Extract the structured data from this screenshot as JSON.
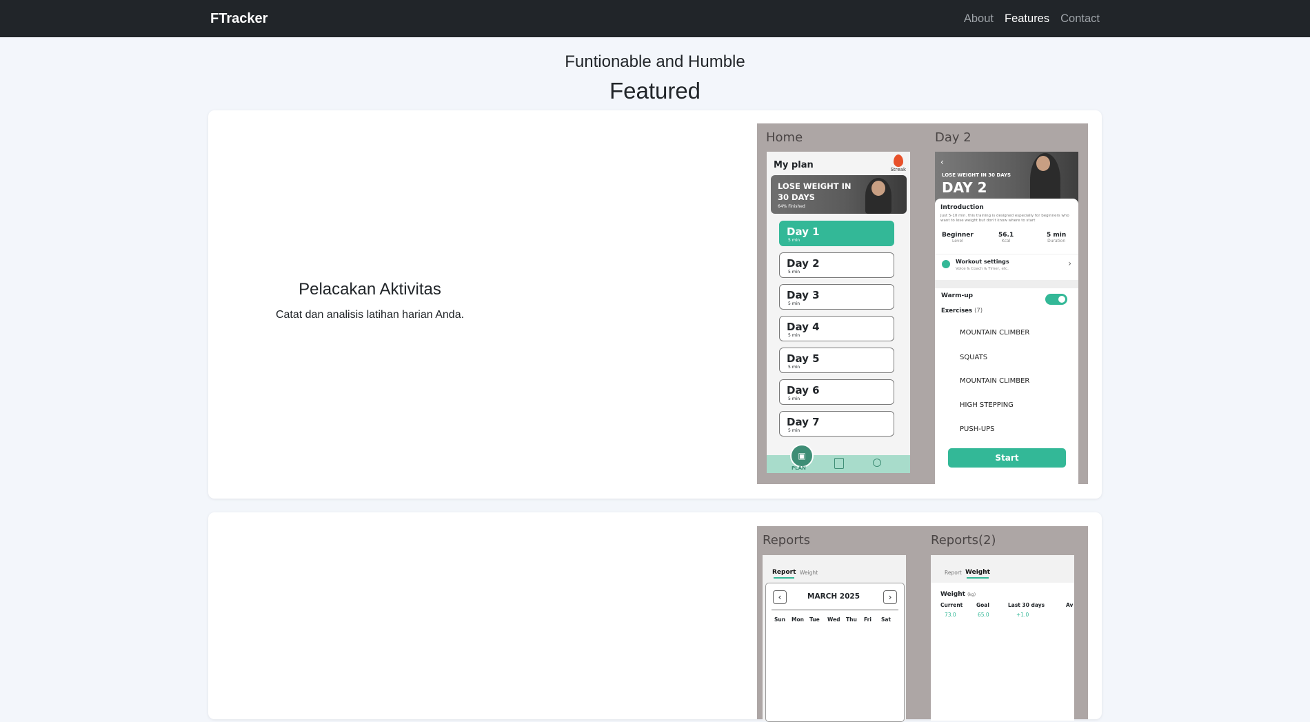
{
  "nav": {
    "brand": "FTracker",
    "links": [
      "About",
      "Features",
      "Contact"
    ]
  },
  "hero": {
    "subtitle": "Funtionable and Humble",
    "title": "Featured"
  },
  "feature1": {
    "title": "Pelacakan Aktivitas",
    "description": "Catat dan analisis latihan harian Anda.",
    "home_screen": {
      "label": "Home",
      "my_plan": "My plan",
      "streak": "Streak",
      "banner_title": "LOSE WEIGHT IN 30 DAYS",
      "banner_line1": "LOSE WEIGHT IN",
      "banner_line2": "30 DAYS",
      "banner_sub": "64% Finished",
      "days": [
        {
          "label": "Day 1",
          "duration": "5 min"
        },
        {
          "label": "Day 2",
          "duration": "5 min"
        },
        {
          "label": "Day 3",
          "duration": "5 min"
        },
        {
          "label": "Day 4",
          "duration": "5 min"
        },
        {
          "label": "Day 5",
          "duration": "5 min"
        },
        {
          "label": "Day 6",
          "duration": "5 min"
        },
        {
          "label": "Day 7",
          "duration": "5 min"
        }
      ],
      "tab_plan": "PLAN"
    },
    "day_screen": {
      "label": "Day 2",
      "back": "‹",
      "hero_small": "LOSE WEIGHT IN 30 DAYS",
      "hero_big": "DAY 2",
      "intro_title": "Introduction",
      "intro_text": "Just 5-10 min. this training is designed especially for beginners who want to lose weight but don't know where to start",
      "stats": [
        {
          "value": "Beginner",
          "label": "Level"
        },
        {
          "value": "56.1",
          "label": "Kcal"
        },
        {
          "value": "5 min",
          "label": "Duration"
        }
      ],
      "settings_title": "Workout settings",
      "settings_sub": "Voice & Coach & Timer, etc.",
      "warmup": "Warm-up",
      "exercises": "Exercises",
      "exercise_count": "(7)",
      "exercise_list": [
        "MOUNTAIN CLIMBER",
        "SQUATS",
        "MOUNTAIN CLIMBER",
        "HIGH STEPPING",
        "PUSH-UPS"
      ],
      "start": "Start"
    }
  },
  "feature2": {
    "reports": {
      "label": "Reports",
      "tabs": [
        "Report",
        "Weight"
      ],
      "month": "MARCH 2025",
      "weekdays": [
        "Sun",
        "Mon",
        "Tue",
        "Wed",
        "Thu",
        "Fri",
        "Sat"
      ]
    },
    "reports2": {
      "label": "Reports(2)",
      "tabs": [
        "Report",
        "Weight"
      ],
      "weight_title": "Weight",
      "weight_unit": "(kg)",
      "columns": [
        "Current",
        "Goal",
        "Last 30 days",
        "Av"
      ],
      "values": [
        "73.0",
        "65.0",
        "+1.0"
      ]
    }
  }
}
